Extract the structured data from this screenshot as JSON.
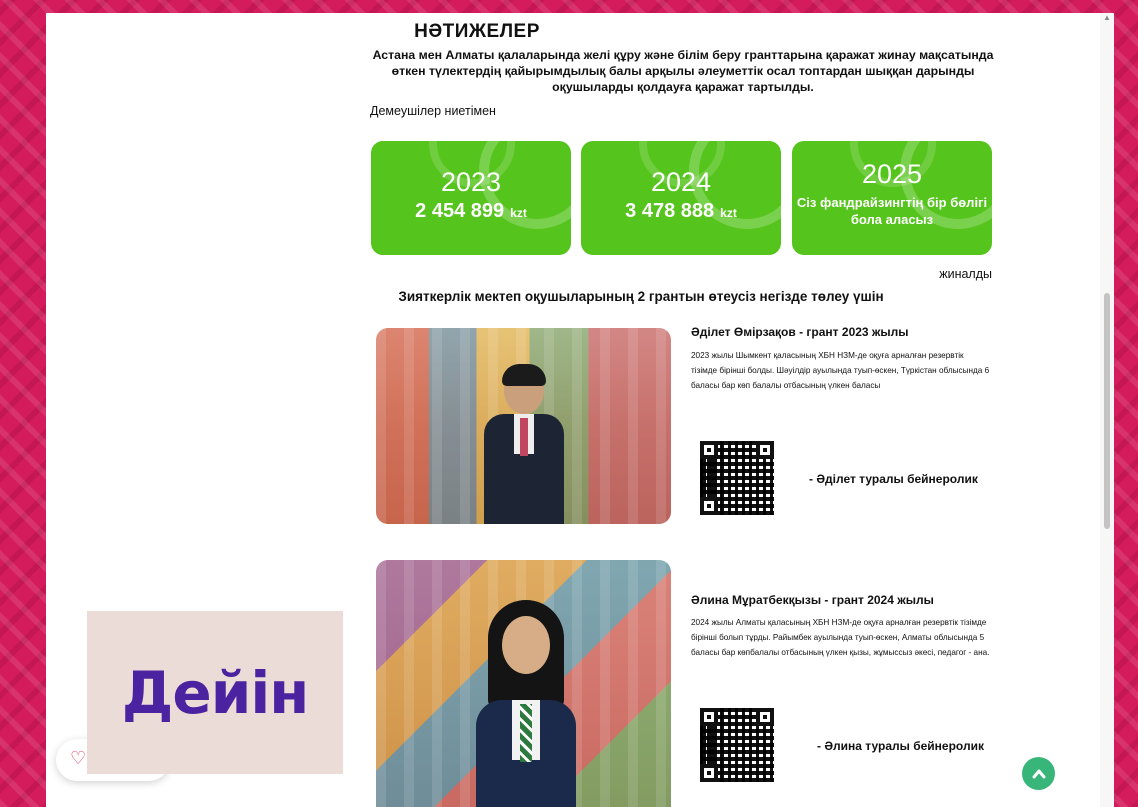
{
  "results": {
    "heading": "НӘТИЖЕЛЕР",
    "intro": "Астана мен Алматы қалаларында желі құру және білім беру гранттарына қаражат жинау мақсатында өткен түлектердің қайырымдылық балы арқылы әлеуметтік осал топтардан шыққан дарынды оқушыларды қолдауға қаражат тартылды.",
    "sponsors_label": "Демеушілер ниетімен",
    "collected_label": "жиналды",
    "grant_subtitle": "Зияткерлік мектеп оқушыларының 2 грантын өтеусіз негізде төлеу үшін"
  },
  "cards": [
    {
      "year": "2023",
      "amount": "2 454 899",
      "currency": "kzt"
    },
    {
      "year": "2024",
      "amount": "3 478 888",
      "currency": "kzt"
    },
    {
      "year": "2025",
      "note": "Сіз фандрайзингтің бір бөлігі бола аласыз"
    }
  ],
  "students": [
    {
      "name": "Әділет Өмірзақов - грант 2023 жылы",
      "description": "2023 жылы Шымкент қаласының ХБН НЗМ-де оқуға арналған резервтік тізімде бірінші болды. Шәуілдір ауылында туып-өскен, Түркістан облысында 6 баласы бар көп балалы отбасының үлкен баласы",
      "video_link": "- Әділет туралы бейнеролик"
    },
    {
      "name": "Әлина Мұратбекқызы - грант 2024 жылы",
      "description": "2024 жылы Алматы қаласының ХБН НЗМ-де оқуға арналған резервтік тізімде бірінші болып тұрды. Райымбек ауылында туып-өскен, Алматы облысында 5 баласы бар көпбалалы отбасының үлкен қызы, жұмыссыз әкесі, педагог - ана.",
      "video_link": "- Әлина туралы бейнеролик"
    }
  ],
  "promo": {
    "text": "Дейін"
  },
  "colors": {
    "accent_green": "#55c41c",
    "brand_pink": "#d41c5c",
    "promo_purple": "#4b22a0",
    "to_top_green": "#38b67a"
  },
  "icons": {
    "like": "heart-icon",
    "to_top": "chevron-up-icon"
  }
}
